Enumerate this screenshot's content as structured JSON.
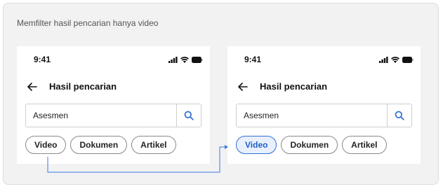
{
  "caption": "Memfilter hasil pencarian hanya video",
  "colors": {
    "accent": "#2f6fd6",
    "chip_active_bg": "#e8f0fd",
    "connector": "#3a7be0"
  },
  "screens": [
    {
      "status": {
        "time": "9:41",
        "icons": [
          "signal-icon",
          "wifi-icon",
          "battery-icon"
        ]
      },
      "header": {
        "back_icon": "arrow-left-icon",
        "title": "Hasil pencarian"
      },
      "search": {
        "value": "Asesmen",
        "button_icon": "search-icon"
      },
      "chips": [
        {
          "label": "Video",
          "selected": false
        },
        {
          "label": "Dokumen",
          "selected": false
        },
        {
          "label": "Artikel",
          "selected": false
        }
      ]
    },
    {
      "status": {
        "time": "9:41",
        "icons": [
          "signal-icon",
          "wifi-icon",
          "battery-icon"
        ]
      },
      "header": {
        "back_icon": "arrow-left-icon",
        "title": "Hasil pencarian"
      },
      "search": {
        "value": "Asesmen",
        "button_icon": "search-icon"
      },
      "chips": [
        {
          "label": "Video",
          "selected": true
        },
        {
          "label": "Dokumen",
          "selected": false
        },
        {
          "label": "Artikel",
          "selected": false
        }
      ]
    }
  ]
}
